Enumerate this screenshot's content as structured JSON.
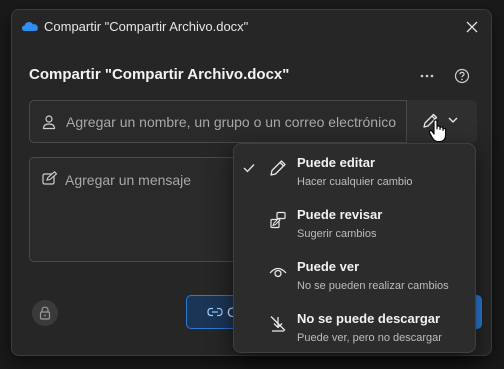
{
  "window": {
    "title": "Compartir \"Compartir Archivo.docx\"",
    "app_icon": "onedrive-cloud-icon",
    "close_icon": "close-icon"
  },
  "dialog": {
    "heading": "Compartir \"Compartir Archivo.docx\"",
    "more_icon": "more-options-icon",
    "help_icon": "help-icon"
  },
  "people": {
    "placeholder": "Agregar un nombre, un grupo o un correo electrónico",
    "value": "",
    "permission_icon": "pencil-icon"
  },
  "message": {
    "placeholder": "Agregar un mensaje",
    "value": ""
  },
  "footer": {
    "copy_label": "C",
    "lock_icon": "lock-icon"
  },
  "menu": {
    "items": [
      {
        "title": "Puede editar",
        "desc": "Hacer cualquier cambio",
        "icon": "pencil-icon",
        "selected": true
      },
      {
        "title": "Puede revisar",
        "desc": "Sugerir cambios",
        "icon": "review-icon",
        "selected": false
      },
      {
        "title": "Puede ver",
        "desc": "No se pueden realizar cambios",
        "icon": "eye-icon",
        "selected": false
      },
      {
        "title": "No se puede descargar",
        "desc": "Puede ver, pero no descargar",
        "icon": "no-download-icon",
        "selected": false
      }
    ]
  },
  "colors": {
    "accent": "#2b7fde",
    "background": "#262626"
  }
}
